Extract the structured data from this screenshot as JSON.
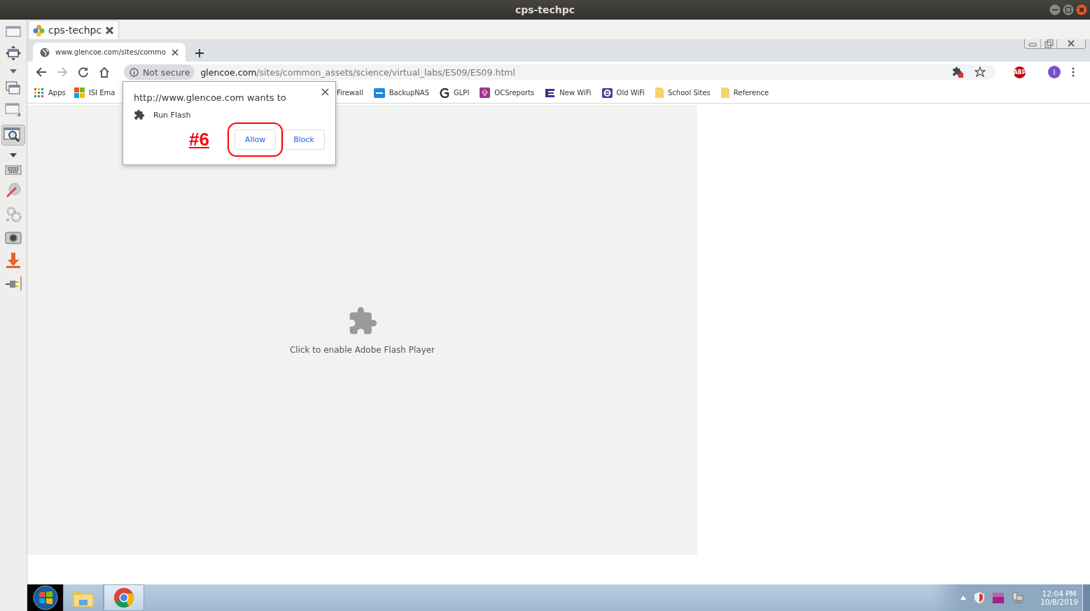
{
  "window": {
    "title": "cps-techpc"
  },
  "session_tabs": [
    {
      "label": "cps-techpc",
      "selected": true
    }
  ],
  "browser": {
    "tabs": [
      {
        "title": "www.glencoe.com/sites/commo",
        "selected": true
      }
    ],
    "address": {
      "security": "Not secure",
      "host": "glencoe.com",
      "path": "/sites/common_assets/science/virtual_labs/ES09/ES09.html"
    },
    "adblock_badge": "ABP",
    "profile_initial": "I",
    "bookmarks": [
      {
        "label": "Apps"
      },
      {
        "label": "ISI Ema"
      },
      {
        "label": "Firewall"
      },
      {
        "label": "BackupNAS"
      },
      {
        "label": "GLPI"
      },
      {
        "label": "OCSreports"
      },
      {
        "label": "New WiFi"
      },
      {
        "label": "Old WiFi"
      },
      {
        "label": "School Sites"
      },
      {
        "label": "Reference"
      }
    ],
    "plugin_placeholder": "Click to enable Adobe Flash Player"
  },
  "permission_popup": {
    "origin_text": "http://www.glencoe.com wants to",
    "permission": "Run Flash",
    "buttons": [
      {
        "label": "Allow",
        "highlighted": true
      },
      {
        "label": "Block",
        "highlighted": false
      }
    ],
    "annotation": "#6"
  },
  "taskbar": {
    "items": [
      {
        "kind": "start",
        "selected": false
      },
      {
        "kind": "folder",
        "selected": false
      },
      {
        "kind": "chrome",
        "selected": true
      }
    ],
    "time": "12:04 PM",
    "date": "10/8/2019"
  }
}
